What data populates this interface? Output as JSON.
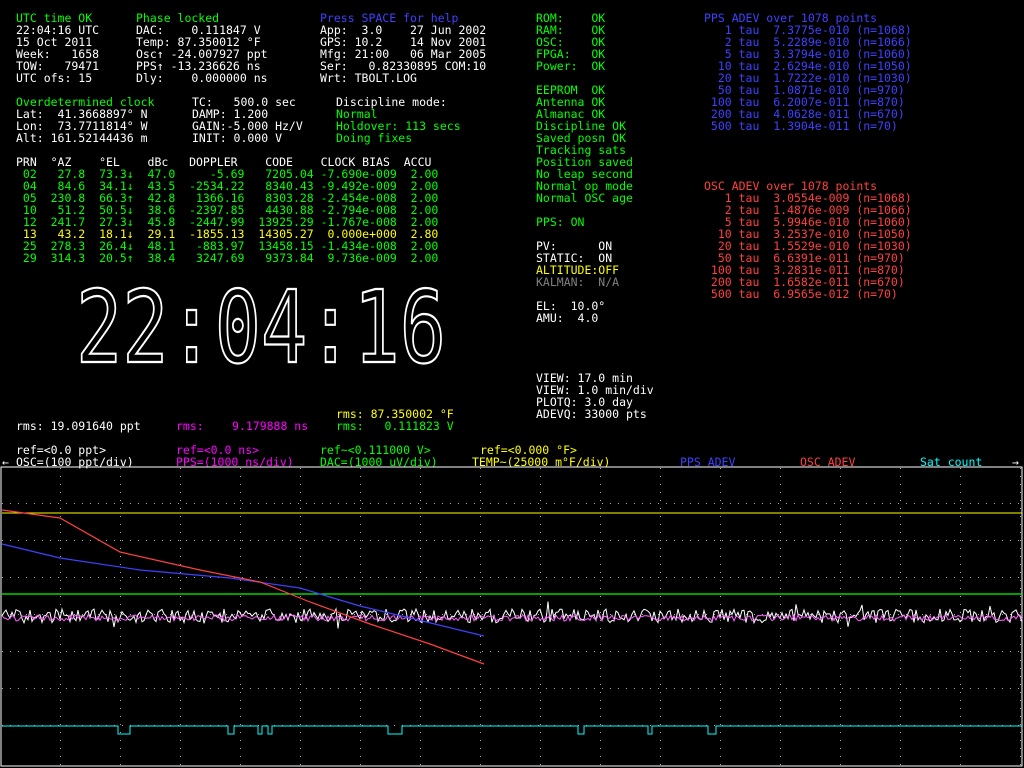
{
  "status": {
    "utc_ok": "UTC time OK",
    "time_utc": "22:04:16 UTC",
    "date": "15 Oct 2011",
    "week": "Week:   1658",
    "tow": "TOW:   79471",
    "utc_ofs": "UTC ofs: 15"
  },
  "phase": {
    "title": "Phase locked",
    "dac": "DAC:    0.111847 V",
    "temp": "Temp: 87.350012 °F",
    "osc": "Osc↑ -24.007927 ppt",
    "pps": "PPS↑ -13.236626 ns",
    "dly": "Dly:    0.000000 ns"
  },
  "help": "Press SPACE for help",
  "version": {
    "app": "App:  3.0    27 Jun 2002",
    "gps": "GPS: 10.2    14 Nov 2001",
    "mfg": "Mfg: 21:00   06 Mar 2005",
    "ser": "Ser:   0.82330895 COM:10",
    "wrt": "Wrt: TBOLT.LOG"
  },
  "health": [
    "ROM:    OK",
    "RAM:    OK",
    "OSC:    OK",
    "FPGA:   OK",
    "Power:  OK"
  ],
  "alarms": [
    "EEPROM  OK",
    "Antenna OK",
    "Almanac OK",
    "Discipline OK",
    "Saved posn OK",
    "Tracking sats",
    "Position saved",
    "No leap second",
    "Normal op mode",
    "Normal OSC age"
  ],
  "pps_on": "PPS: ON",
  "flags": {
    "pv": "PV:      ON",
    "static": "STATIC:  ON",
    "altitude": "ALTITUDE:OFF",
    "kalman": "KALMAN:  N/A"
  },
  "el": "EL:  10.0°",
  "amu": "AMU:  4.0",
  "view": {
    "span": "VIEW: 17.0 min",
    "div": "VIEW: 1.0 min/div",
    "plotq": "PLOTQ: 3.0 day",
    "adevq": "ADEVQ: 33000 pts"
  },
  "position": {
    "mode": "Overdetermined clock",
    "lat": "Lat:  41.3668897° N",
    "lon": "Lon:  73.7711814° W",
    "alt": "Alt: 161.52144436 m",
    "tc": "TC:   500.0 sec",
    "damp": "DAMP: 1.200",
    "gain": "GAIN:-5.000 Hz/V",
    "init": "INIT: 0.000 V"
  },
  "discipline": {
    "label": "Discipline mode:",
    "mode": "Normal",
    "holdover": "Holdover: 113 secs",
    "fixes": "Doing fixes"
  },
  "sat_table": {
    "header": "PRN  °AZ    °EL    dBc   DOPPLER    CODE    CLOCK BIAS  ACCU",
    "rows": [
      " 02   27.8  73.3↓  47.0     -5.69   7205.04 -7.690e-009  2.00",
      " 04   84.6  34.1↓  43.5  -2534.22   8340.43 -9.492e-009  2.00",
      " 05  230.8  66.3↑  42.8   1366.16   8303.28 -2.454e-008  2.00",
      " 10   51.2  50.5↓  38.6  -2397.85   4430.88 -2.794e-008  2.00",
      " 12  241.7  27.3↓  45.8  -2447.99  13925.29 -1.767e-008  2.00",
      " 13   43.2  18.1↓  29.1  -1855.13  14305.27  0.000e+000  2.80",
      " 25  278.3  26.4↓  48.1   -883.97  13458.15 -1.434e-008  2.00",
      " 29  314.3  20.5↑  38.4   3247.69   9373.84  9.736e-009  2.00"
    ]
  },
  "clock_digits": "22:04:16",
  "rms": {
    "ppt": "rms: 19.091640 ppt",
    "ns_label": "rms:",
    "ns_value": "9.179888 ns",
    "temp": "rms: 87.350002 °F",
    "volt": "rms:   0.111823 V"
  },
  "pps_adev": {
    "title": "PPS ADEV over 1078 points",
    "rows": [
      "   1 tau  7.3775e-010 (n=1068)",
      "   2 tau  5.2289e-010 (n=1066)",
      "   5 tau  3.3794e-010 (n=1060)",
      "  10 tau  2.6294e-010 (n=1050)",
      "  20 tau  1.7222e-010 (n=1030)",
      "  50 tau  1.0871e-010 (n=970)",
      " 100 tau  6.2007e-011 (n=870)",
      " 200 tau  4.0628e-011 (n=670)",
      " 500 tau  1.3904e-011 (n=70)"
    ]
  },
  "osc_adev": {
    "title": "OSC ADEV over 1078 points",
    "rows": [
      "   1 tau  3.0554e-009 (n=1068)",
      "   2 tau  1.4876e-009 (n=1066)",
      "   5 tau  5.9946e-010 (n=1060)",
      "  10 tau  3.2537e-010 (n=1050)",
      "  20 tau  1.5529e-010 (n=1030)",
      "  50 tau  6.6391e-011 (n=970)",
      " 100 tau  3.2831e-011 (n=870)",
      " 200 tau  1.6582e-011 (n=670)",
      " 500 tau  6.9565e-012 (n=70)"
    ]
  },
  "legend": {
    "osc_ref": "ref=<0.0 ppt>",
    "osc_scale": "OSC=(100 ppt/div)",
    "pps_ref": "ref=<0.0 ns>",
    "pps_scale": "PPS=(1000 ns/div)",
    "dac_ref": "ref~<0.111000 V>",
    "dac_scale": "DAC=(1000 uV/div)",
    "temp_ref": "ref=<0.000 °F>",
    "temp_scale": "TEMP~(25000 m°F/div)",
    "pps_adev": "PPS ADEV",
    "osc_adev": "OSC ADEV",
    "sat_count": "Sat count",
    "arrow_left": "←",
    "arrow_right": "→"
  },
  "colors": {
    "background": "#000000",
    "grid": "#ffffff",
    "osc_trace": "#ffffff",
    "pps_trace": "#ff00ff",
    "dac_trace": "#00ff00",
    "temp_trace": "#ffff00",
    "pps_adev": "#4040ff",
    "osc_adev": "#ff4040",
    "sat_count": "#00ffff"
  }
}
